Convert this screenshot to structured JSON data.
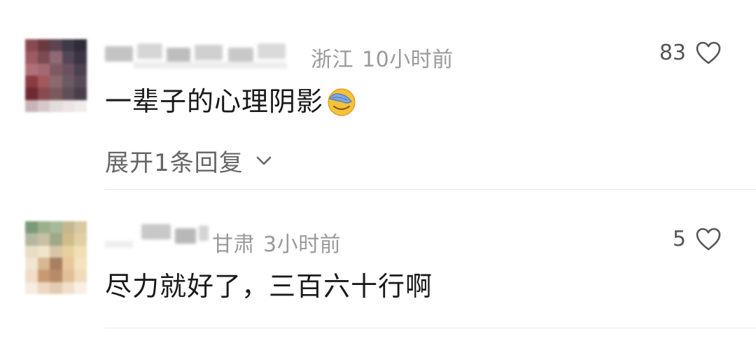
{
  "comments": [
    {
      "location": "浙江",
      "time": "10小时前",
      "likes": "83",
      "text": "一辈子的心理阴影",
      "emoji": "face-with-hand-over-eyes",
      "replies_label": "展开1条回复"
    },
    {
      "location": "甘肃",
      "time": "3小时前",
      "likes": "5",
      "text": "尽力就好了，三百六十行啊"
    }
  ],
  "colors": {
    "meta": "#9a9a9a",
    "text": "#1a1a1a",
    "replies": "#666666",
    "divider": "#e8e8e8"
  }
}
